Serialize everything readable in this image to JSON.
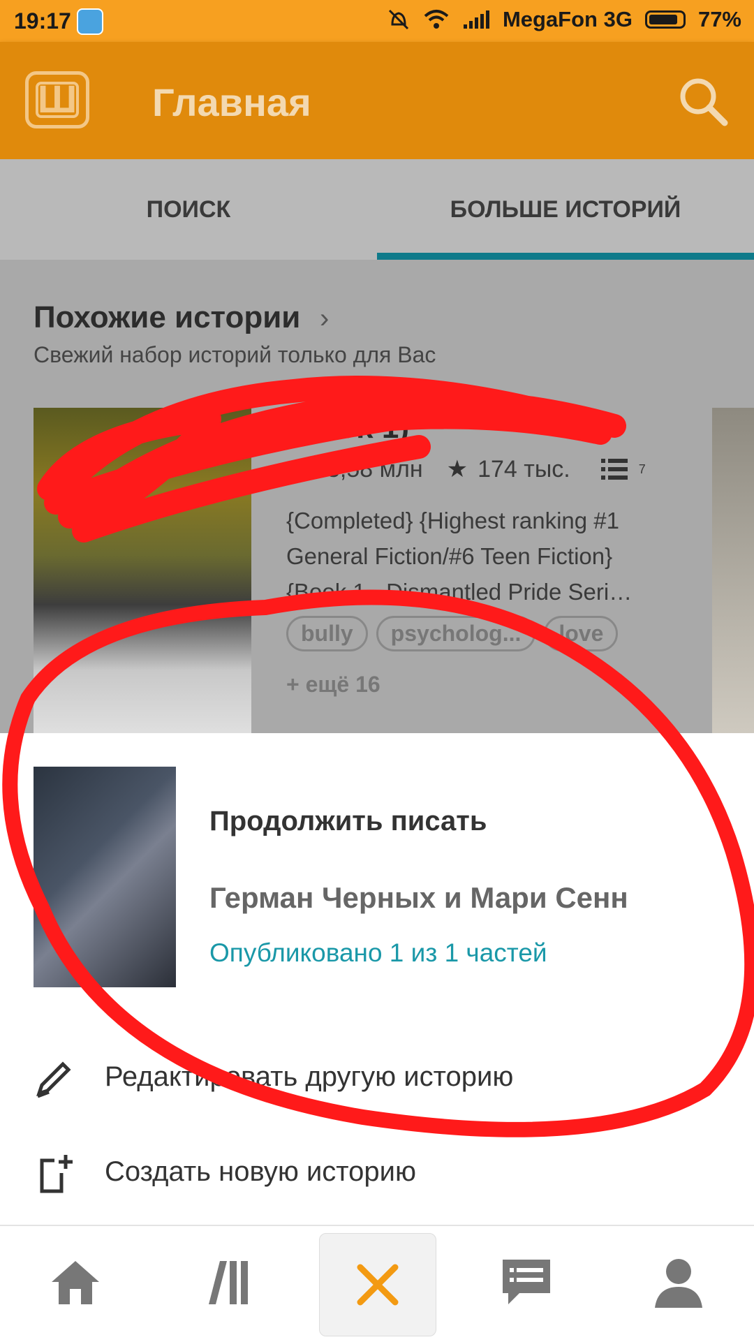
{
  "status_bar": {
    "time": "19:17",
    "carrier": "MegaFon 3G",
    "battery": "77%",
    "battery_level": 0.77
  },
  "app_bar": {
    "title": "Главная",
    "logo_letter": "Ш",
    "search_icon": "search-icon"
  },
  "tabs": [
    {
      "label": "ПОИСК",
      "active": false
    },
    {
      "label": "БОЛЬШЕ ИСТОРИЙ",
      "active": true
    }
  ],
  "section": {
    "title": "Похожие истории",
    "subtitle": "Свежий набор историй только для Вас",
    "card": {
      "title": "(Book 1)",
      "views": "3,58 млн",
      "votes": "174 тыс.",
      "parts": "7",
      "description": "{Completed} {Highest ranking #1 General Fiction/#6 Teen Fiction} {Book 1 - Dismantled Pride Seri…",
      "tags": [
        "bully",
        "psycholog...",
        "love"
      ],
      "more_tags": "+ ещё 16"
    }
  },
  "sheet": {
    "continue_label": "Продолжить писать",
    "story_title": "Герман Черных и Мари Сенн",
    "published": "Опубликовано 1 из 1 частей",
    "actions": [
      {
        "label": "Редактировать другую историю",
        "icon": "pencil-icon"
      },
      {
        "label": "Создать новую историю",
        "icon": "new-document-icon"
      }
    ]
  },
  "bottom_nav": [
    {
      "icon": "home-icon"
    },
    {
      "icon": "library-icon"
    },
    {
      "icon": "close-icon",
      "active": true
    },
    {
      "icon": "messages-icon"
    },
    {
      "icon": "profile-icon"
    }
  ],
  "colors": {
    "accent": "#e08a0c",
    "status_bar": "#f7a020",
    "tab_indicator": "#0f7a8a",
    "published_text": "#1a98a8",
    "annotation_red": "#ff1a1a"
  }
}
